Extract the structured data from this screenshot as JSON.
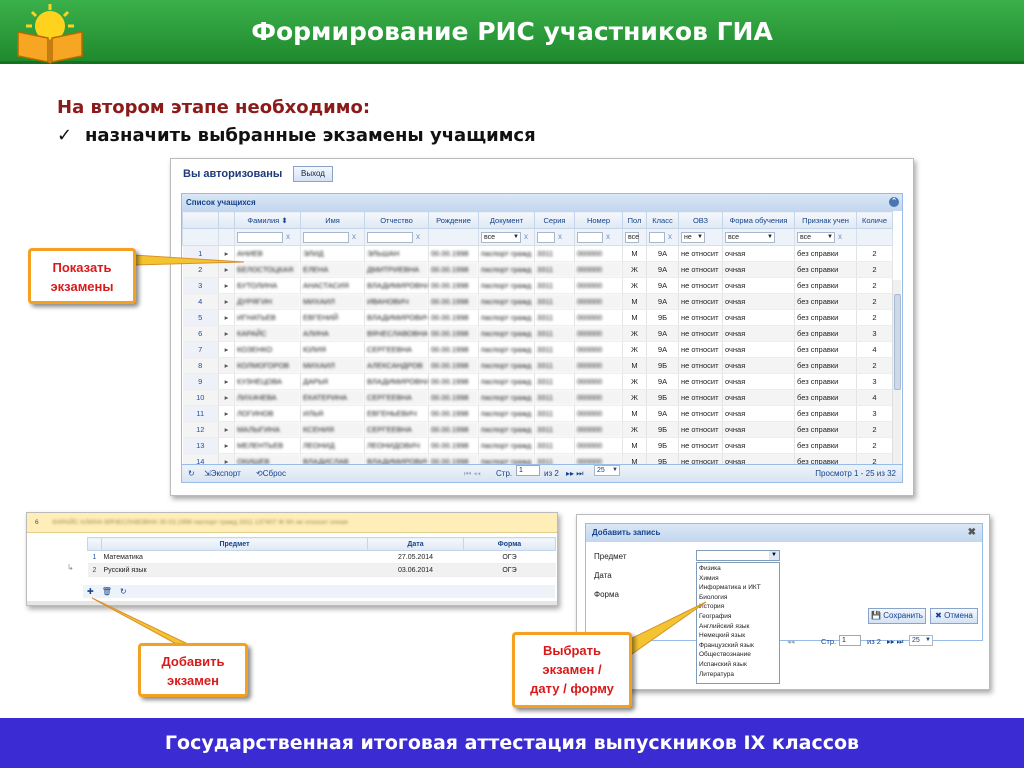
{
  "header": {
    "title": "Формирование РИС участников ГИА"
  },
  "intro": {
    "line1": "На втором этапе необходимо:",
    "check_mark": "✓",
    "line2": "назначить выбранные экзамены учащимся"
  },
  "win1": {
    "auth_label": "Вы авторизованы",
    "logout_label": "Выход",
    "grid_title": "Список учащихся",
    "columns": [
      "Фамилия",
      "Имя",
      "Отчество",
      "Рождение",
      "Документ",
      "Серия",
      "Номер",
      "Пол",
      "Класс",
      "ОВЗ",
      "Форма обучения",
      "Признак учен",
      "Количе"
    ],
    "filter_all": "все",
    "filter_ne": "не",
    "rows": [
      {
        "n": "1",
        "pol": "М",
        "klass": "9А",
        "ovz": "не относит",
        "forma": "очная",
        "priznak": "без справки",
        "kol": "2"
      },
      {
        "n": "2",
        "pol": "Ж",
        "klass": "9А",
        "ovz": "не относит",
        "forma": "очная",
        "priznak": "без справки",
        "kol": "2"
      },
      {
        "n": "3",
        "pol": "Ж",
        "klass": "9А",
        "ovz": "не относит",
        "forma": "очная",
        "priznak": "без справки",
        "kol": "2"
      },
      {
        "n": "4",
        "pol": "М",
        "klass": "9А",
        "ovz": "не относит",
        "forma": "очная",
        "priznak": "без справки",
        "kol": "2"
      },
      {
        "n": "5",
        "pol": "М",
        "klass": "9Б",
        "ovz": "не относит",
        "forma": "очная",
        "priznak": "без справки",
        "kol": "2"
      },
      {
        "n": "6",
        "pol": "Ж",
        "klass": "9А",
        "ovz": "не относит",
        "forma": "очная",
        "priznak": "без справки",
        "kol": "3"
      },
      {
        "n": "7",
        "pol": "Ж",
        "klass": "9А",
        "ovz": "не относит",
        "forma": "очная",
        "priznak": "без справки",
        "kol": "4"
      },
      {
        "n": "8",
        "pol": "М",
        "klass": "9Б",
        "ovz": "не относит",
        "forma": "очная",
        "priznak": "без справки",
        "kol": "2"
      },
      {
        "n": "9",
        "pol": "Ж",
        "klass": "9А",
        "ovz": "не относит",
        "forma": "очная",
        "priznak": "без справки",
        "kol": "3"
      },
      {
        "n": "10",
        "pol": "Ж",
        "klass": "9Б",
        "ovz": "не относит",
        "forma": "очная",
        "priznak": "без справки",
        "kol": "4"
      },
      {
        "n": "11",
        "pol": "М",
        "klass": "9А",
        "ovz": "не относит",
        "forma": "очная",
        "priznak": "без справки",
        "kol": "3"
      },
      {
        "n": "12",
        "pol": "Ж",
        "klass": "9Б",
        "ovz": "не относит",
        "forma": "очная",
        "priznak": "без справки",
        "kol": "2"
      },
      {
        "n": "13",
        "pol": "М",
        "klass": "9Б",
        "ovz": "не относит",
        "forma": "очная",
        "priznak": "без справки",
        "kol": "2"
      },
      {
        "n": "14",
        "pol": "М",
        "klass": "9Б",
        "ovz": "не относит",
        "forma": "очная",
        "priznak": "без справки",
        "kol": "2"
      }
    ],
    "export_label": "Экспорт",
    "reset_label": "Сброс",
    "page_label": "Стр.",
    "page_value": "1",
    "of_label": "из 2",
    "page_size": "25",
    "view_label": "Просмотр 1 - 25 из 32"
  },
  "win2": {
    "row_num": "6",
    "columns": [
      "Предмет",
      "Дата",
      "Форма"
    ],
    "rows": [
      {
        "n": "1",
        "subject": "Математика",
        "date": "27.05.2014",
        "form": "ОГЭ"
      },
      {
        "n": "2",
        "subject": "Русский язык",
        "date": "03.06.2014",
        "form": "ОГЭ"
      }
    ]
  },
  "win3": {
    "title": "Добавить запись",
    "labels": [
      "Предмет",
      "Дата",
      "Форма"
    ],
    "options": [
      "Физика",
      "Химия",
      "Информатика и ИКТ",
      "Биология",
      "История",
      "География",
      "Английский язык",
      "Немецкий язык",
      "Французский язык",
      "Обществознание",
      "Испанский язык",
      "Литература"
    ],
    "save_label": "Сохранить",
    "cancel_label": "Отмена",
    "page_label": "Стр.",
    "page_value": "1",
    "of_label": "из 2",
    "page_size": "25"
  },
  "callouts": {
    "show_line1": "Показать",
    "show_line2": "экзамены",
    "add_line1": "Добавить",
    "add_line2": "экзамен",
    "choose_line1": "Выбрать",
    "choose_line2": "экзамен /",
    "choose_line3": "дату / форму"
  },
  "footer": {
    "title": "Государственная итоговая аттестация выпускников IX классов"
  },
  "colors": {
    "header": "#2e9e3c",
    "footer": "#3a2bd2",
    "callout_border": "#f4a020",
    "callout_text": "#d91a1a",
    "intro_red": "#8b1a1a"
  }
}
